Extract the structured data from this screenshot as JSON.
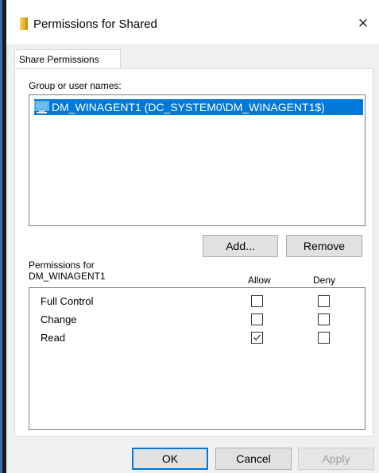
{
  "window": {
    "title": "Permissions for Shared",
    "close_label": "✕"
  },
  "tabs": [
    {
      "label": "Share Permissions",
      "selected": true
    }
  ],
  "group_section": {
    "label": "Group or user names:",
    "users": [
      {
        "name": "DM_WINAGENT1 (DC_SYSTEM0\\DM_WINAGENT1$)",
        "selected": true
      }
    ],
    "add_label": "Add...",
    "remove_label": "Remove"
  },
  "permissions": {
    "header_line1": "Permissions for",
    "header_line2": "DM_WINAGENT1",
    "allow_label": "Allow",
    "deny_label": "Deny",
    "rows": [
      {
        "name": "Full Control",
        "allow": false,
        "deny": false
      },
      {
        "name": "Change",
        "allow": false,
        "deny": false
      },
      {
        "name": "Read",
        "allow": true,
        "deny": false
      }
    ]
  },
  "footer": {
    "ok_label": "OK",
    "cancel_label": "Cancel",
    "apply_label": "Apply"
  },
  "colors": {
    "selection": "#0078d7",
    "panel_bg": "#f0f0f0",
    "button_bg": "#e1e1e1"
  }
}
